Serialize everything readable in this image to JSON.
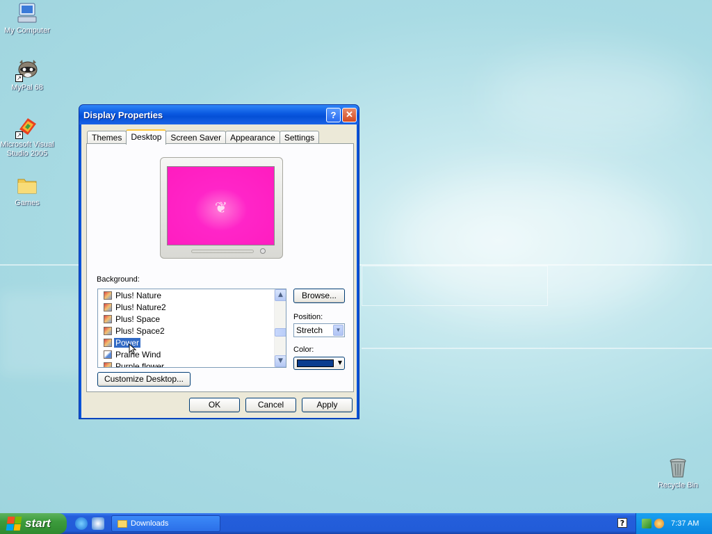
{
  "desktop": {
    "icons": [
      {
        "label": "My Computer"
      },
      {
        "label": "MyPal 68"
      },
      {
        "label": "Microsoft Visual Studio 2005"
      },
      {
        "label": "Games"
      },
      {
        "label": "Recycle Bin"
      }
    ]
  },
  "window": {
    "title": "Display Properties",
    "help_label": "?",
    "close_label": "✕",
    "tabs": [
      {
        "label": "Themes"
      },
      {
        "label": "Desktop"
      },
      {
        "label": "Screen Saver"
      },
      {
        "label": "Appearance"
      },
      {
        "label": "Settings"
      }
    ],
    "active_tab": "Desktop",
    "background_label": "Background:",
    "background_items": [
      {
        "label": "Plus! Nature"
      },
      {
        "label": "Plus! Nature2"
      },
      {
        "label": "Plus! Space"
      },
      {
        "label": "Plus! Space2"
      },
      {
        "label": "Power"
      },
      {
        "label": "Prairie Wind"
      },
      {
        "label": "Purple flower"
      }
    ],
    "selected_background": "Power",
    "browse_label": "Browse...",
    "position_label": "Position:",
    "position_value": "Stretch",
    "color_label": "Color:",
    "color_value": "#0a3d8f",
    "customize_label": "Customize Desktop...",
    "ok_label": "OK",
    "cancel_label": "Cancel",
    "apply_label": "Apply",
    "preview_color": "#ff1cbf"
  },
  "taskbar": {
    "start_label": "start",
    "task_buttons": [
      {
        "label": "Downloads"
      }
    ],
    "clock": "7:37 AM",
    "help_label": "?"
  }
}
